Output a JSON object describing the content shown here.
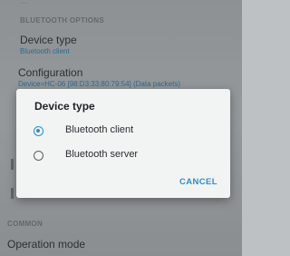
{
  "background": {
    "top_fragment": "...",
    "section_bluetooth": "BLUETOOTH OPTIONS",
    "device_type": {
      "title": "Device type",
      "summary": "Bluetooth client"
    },
    "configuration": {
      "title": "Configuration",
      "summary": "Device=HC-06 [98:D3:33:80:79:54] (Data packets)"
    },
    "section_common": "COMMON",
    "operation_mode": {
      "title": "Operation mode"
    }
  },
  "dialog": {
    "title": "Device type",
    "options": [
      {
        "label": "Bluetooth client",
        "selected": true
      },
      {
        "label": "Bluetooth server",
        "selected": false
      }
    ],
    "cancel_label": "CANCEL"
  },
  "colors": {
    "accent": "#2b8fcf",
    "summary_text": "#2f86b8"
  }
}
